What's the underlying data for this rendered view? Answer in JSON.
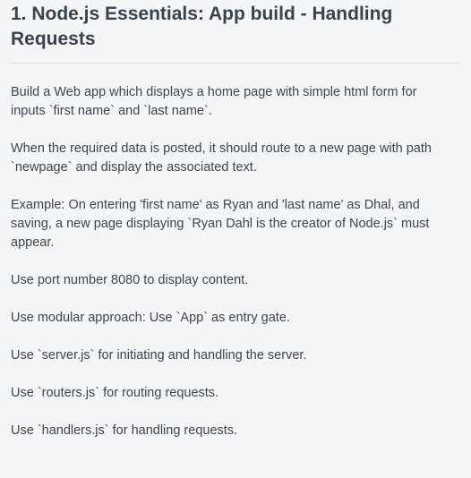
{
  "challenge": {
    "title": "1. Node.js Essentials: App build - Handling Requests",
    "paragraphs": [
      "Build a Web app which displays a home page with simple html form for inputs `first name` and `last name`.",
      "When the required data is posted, it should route to a new page with path `newpage` and display the associated text.",
      "Example: On entering 'first name' as Ryan and 'last name' as Dhal, and saving, a new page displaying `Ryan Dahl is the creator of Node.js` must appear.",
      "Use port number 8080 to display content.",
      "Use modular approach: Use `App` as entry gate.",
      "Use `server.js` for initiating and handling the server.",
      "Use `routers.js` for routing requests.",
      "Use `handlers.js` for handling requests."
    ]
  }
}
